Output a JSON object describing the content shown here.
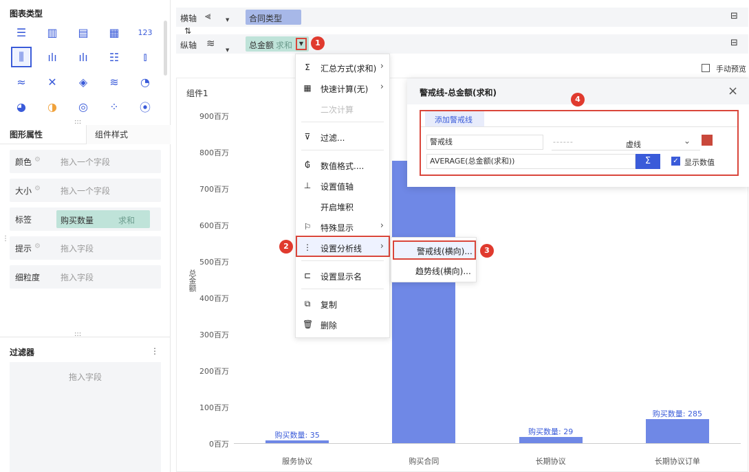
{
  "left": {
    "chart_type_title": "图表类型",
    "chart_icons": [
      "table-icon",
      "crosstab-icon",
      "detail-table-icon",
      "kpi-table-icon",
      "number-icon",
      "grouped-bar-icon",
      "multi-bar-icon",
      "stacked-bar-icon",
      "horizontal-bar-icon",
      "waterfall-icon",
      "line-icon",
      "radar-line-icon",
      "radar-icon",
      "area-icon",
      "gauge-icon",
      "pie-icon",
      "rose-icon",
      "ring-icon",
      "scatter-icon",
      "bubble-icon"
    ],
    "number_icon_text": "123",
    "tabs": {
      "graphic_props": "图形属性",
      "component_style": "组件样式"
    },
    "props": [
      {
        "label": "颜色",
        "value": "拖入一个字段"
      },
      {
        "label": "大小",
        "value": "拖入一个字段"
      },
      {
        "label": "标签",
        "pill": "购买数量",
        "pill_agg": "求和"
      },
      {
        "label": "提示",
        "value": "拖入字段"
      },
      {
        "label": "细粒度",
        "value": "拖入字段"
      }
    ],
    "filter_title": "过滤器",
    "filter_placeholder": "拖入字段",
    "drag_handle": ":::"
  },
  "axes": {
    "x_label": "横轴",
    "x_field": "合同类型",
    "swap_icon": "⇅",
    "y_label": "纵轴",
    "y_field": "总金额",
    "y_agg": "求和",
    "manual_preview": "手动预览"
  },
  "chart": {
    "component_title": "组件1",
    "y_axis_title": "总金额",
    "chart_data": {
      "type": "bar",
      "categories": [
        "服务协议",
        "购买合同",
        "长期协议",
        "长期协议订单"
      ],
      "values": [
        8,
        775,
        17,
        66
      ],
      "ylim": [
        0,
        900
      ],
      "yticks": [
        "0百万",
        "100百万",
        "200百万",
        "300百万",
        "400百万",
        "500百万",
        "600百万",
        "700百万",
        "800百万",
        "900百万"
      ],
      "data_labels": [
        "购买数量: 35",
        "购买",
        "购买数量: 29",
        "购买数量: 285"
      ],
      "ylabel": "总金额"
    }
  },
  "menu": {
    "items": [
      {
        "icon": "Σ",
        "label": "汇总方式(求和)",
        "arrow": "›"
      },
      {
        "icon": "▦",
        "label": "快速计算(无)",
        "arrow": "›"
      },
      {
        "icon": "",
        "label": "二次计算",
        "arrow": ""
      },
      {
        "icon": "⊽",
        "label": "过滤...",
        "arrow": ""
      },
      {
        "icon": "₲",
        "label": "数值格式....",
        "arrow": ""
      },
      {
        "icon": "⊥",
        "label": "设置值轴",
        "arrow": ""
      },
      {
        "icon": "",
        "label": "开启堆积",
        "arrow": ""
      },
      {
        "icon": "⚐",
        "label": "特殊显示",
        "arrow": "›"
      },
      {
        "icon": "⋮",
        "label": "设置分析线",
        "arrow": "›"
      },
      {
        "icon": "⊏",
        "label": "设置显示名",
        "arrow": ""
      },
      {
        "icon": "⧉",
        "label": "复制",
        "arrow": ""
      },
      {
        "icon": "🗑",
        "label": "删除",
        "arrow": ""
      }
    ],
    "submenu": [
      "警戒线(横向)...",
      "趋势线(横向)..."
    ]
  },
  "dialog": {
    "title": "警戒线-总金额(求和)",
    "close": "×",
    "add_tab": "添加警戒线",
    "name_value": "警戒线",
    "line_style_preview": "------",
    "line_style": "虚线",
    "formula": "AVERAGE(总金额(求和))",
    "sigma": "Σ",
    "show_value": "显示数值",
    "color": "#c9483b"
  },
  "badges": [
    "1",
    "2",
    "3",
    "4"
  ],
  "colors": {
    "accent": "#3a5bd9",
    "bar": "#6f88e6",
    "badge": "#e03a2e"
  }
}
